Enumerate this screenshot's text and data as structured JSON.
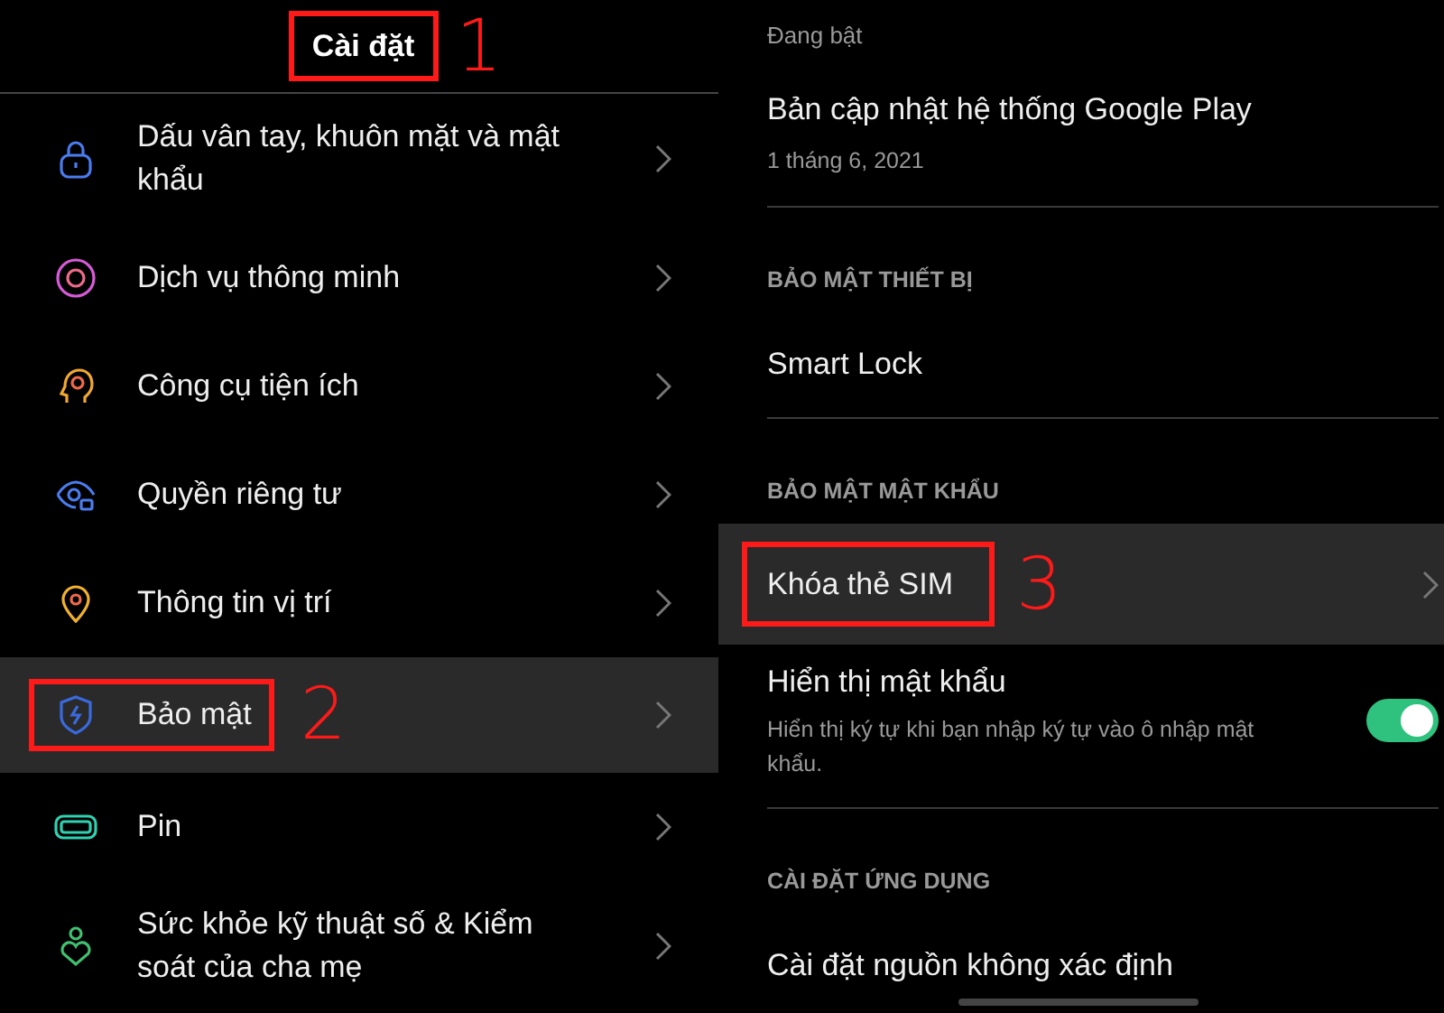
{
  "left": {
    "title": "Cài đặt",
    "title_annotation": "1",
    "items": [
      {
        "label": "Dấu vân tay, khuôn mặt và mật khẩu",
        "selected": false
      },
      {
        "label": "Dịch vụ thông minh",
        "selected": false
      },
      {
        "label": "Công cụ tiện ích",
        "selected": false
      },
      {
        "label": "Quyền riêng tư",
        "selected": false
      },
      {
        "label": "Thông tin vị trí",
        "selected": false
      },
      {
        "label": "Bảo mật",
        "selected": true,
        "annotation": "2"
      },
      {
        "label": "Pin",
        "selected": false
      },
      {
        "label": "Sức khỏe kỹ thuật số & Kiểm soát của cha mẹ",
        "selected": false
      }
    ]
  },
  "right": {
    "rows": [
      {
        "kind": "subtitle",
        "text": "Đang bật"
      },
      {
        "kind": "item",
        "title": "Bản cập nhật hệ thống Google Play",
        "subtitle": "1 tháng 6, 2021",
        "chevron": false,
        "selected": false
      },
      {
        "kind": "divider"
      },
      {
        "kind": "header",
        "text": "BẢO MẬT THIẾT BỊ"
      },
      {
        "kind": "item",
        "title": "Smart Lock",
        "chevron": false,
        "selected": false
      },
      {
        "kind": "divider"
      },
      {
        "kind": "header",
        "text": "BẢO MẬT MẬT KHẨU"
      },
      {
        "kind": "item",
        "title": "Khóa thẻ SIM",
        "chevron": true,
        "selected": true,
        "annotation": "3"
      },
      {
        "kind": "toggle",
        "title": "Hiển thị mật khẩu",
        "subtitle": "Hiển thị ký tự khi bạn nhập ký tự vào ô nhập mật khẩu.",
        "on": true
      },
      {
        "kind": "divider"
      },
      {
        "kind": "header",
        "text": "CÀI ĐẶT ỨNG DỤNG"
      },
      {
        "kind": "item",
        "title": "Cài đặt nguồn không xác định",
        "chevron": false,
        "selected": false
      }
    ]
  }
}
